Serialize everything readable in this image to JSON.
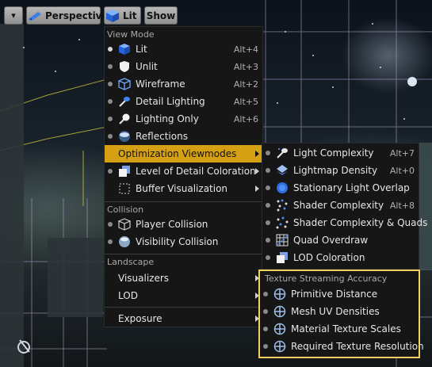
{
  "toolbar": {
    "dropdown_label": "▾",
    "perspective_label": "Perspective",
    "lit_label": "Lit",
    "show_label": "Show"
  },
  "main_menu": {
    "view_mode_header": "View Mode",
    "view_modes": [
      {
        "label": "Lit",
        "shortcut": "Alt+4",
        "icon": "lit-cube-icon"
      },
      {
        "label": "Unlit",
        "shortcut": "Alt+3",
        "icon": "unlit-shield-icon"
      },
      {
        "label": "Wireframe",
        "shortcut": "Alt+2",
        "icon": "wireframe-cube-icon"
      },
      {
        "label": "Detail Lighting",
        "shortcut": "Alt+5",
        "icon": "detail-lighting-icon"
      },
      {
        "label": "Lighting Only",
        "shortcut": "Alt+6",
        "icon": "lighting-only-icon"
      },
      {
        "label": "Reflections",
        "shortcut": "",
        "icon": "reflections-sphere-icon"
      }
    ],
    "optimization_label": "Optimization Viewmodes",
    "lod_coloration_label": "Level of Detail Coloration",
    "buffer_visualization_label": "Buffer Visualization",
    "collision_header": "Collision",
    "player_collision_label": "Player Collision",
    "visibility_collision_label": "Visibility Collision",
    "landscape_header": "Landscape",
    "visualizers_label": "Visualizers",
    "lod_label": "LOD",
    "exposure_label": "Exposure"
  },
  "submenu": {
    "items": [
      {
        "label": "Light Complexity",
        "shortcut": "Alt+7",
        "icon": "light-complexity-icon"
      },
      {
        "label": "Lightmap Density",
        "shortcut": "Alt+0",
        "icon": "lightmap-density-icon"
      },
      {
        "label": "Stationary Light Overlap",
        "shortcut": "",
        "icon": "stationary-light-icon"
      },
      {
        "label": "Shader Complexity",
        "shortcut": "Alt+8",
        "icon": "shader-complexity-icon"
      },
      {
        "label": "Shader Complexity & Quads",
        "shortcut": "",
        "icon": "shader-quads-icon"
      },
      {
        "label": "Quad Overdraw",
        "shortcut": "",
        "icon": "quad-overdraw-icon"
      },
      {
        "label": "LOD Coloration",
        "shortcut": "",
        "icon": "lod-coloration-icon"
      }
    ],
    "texture_header": "Texture Streaming Accuracy",
    "texture_items": [
      {
        "label": "Primitive Distance",
        "icon": "crosshair-icon"
      },
      {
        "label": "Mesh UV Densities",
        "icon": "crosshair-icon"
      },
      {
        "label": "Material Texture Scales",
        "icon": "crosshair-icon"
      },
      {
        "label": "Required Texture Resolution",
        "icon": "crosshair-icon"
      }
    ]
  },
  "colors": {
    "selection": "#d6a014",
    "highlight_box": "#f0d060",
    "menu_bg": "#161616"
  }
}
